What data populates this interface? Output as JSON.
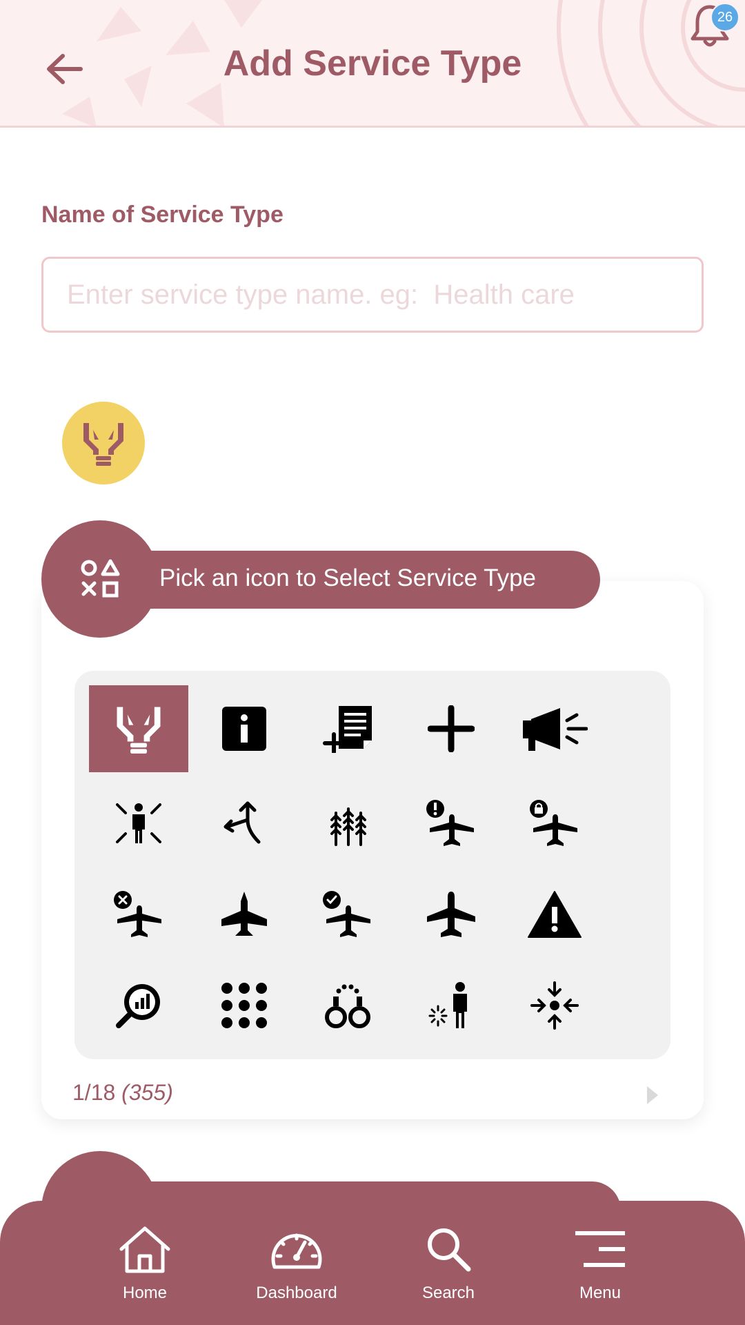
{
  "header": {
    "title": "Add Service Type",
    "notification_count": "26",
    "icons": {
      "back": "arrow-left-icon",
      "notifications": "bell-icon"
    }
  },
  "form": {
    "name_label": "Name of Service Type",
    "name_value": "",
    "name_placeholder": "Enter service type name. eg:  Health care",
    "selected_icon": "hands-holding-child-icon"
  },
  "picker": {
    "title": "Pick an icon to Select Service Type",
    "header_icon": "shapes-icon",
    "page": "1/18",
    "total": "(355)",
    "selected_index": 0,
    "icons": [
      "hands-holding-child-icon",
      "info-icon",
      "file-circle-plus-icon",
      "plus-icon",
      "bullhorn-icon",
      "person-burst-icon",
      "route-split-icon",
      "wheat-awn-icon",
      "plane-circle-exclamation-icon",
      "plane-lock-icon",
      "plane-circle-xmark-icon",
      "fighter-jet-icon",
      "plane-circle-check-icon",
      "plane-icon",
      "triangle-exclamation-icon",
      "magnifying-glass-chart-icon",
      "grid-dots-icon",
      "handcuffs-icon",
      "person-rays-icon",
      "arrows-to-dot-icon"
    ]
  },
  "nav": {
    "items": [
      {
        "label": "Home",
        "icon": "home-icon"
      },
      {
        "label": "Dashboard",
        "icon": "gauge-icon"
      },
      {
        "label": "Search",
        "icon": "search-icon"
      },
      {
        "label": "Menu",
        "icon": "menu-icon"
      }
    ]
  },
  "colors": {
    "primary": "#9e5a65",
    "header_bg": "#fdf0f0",
    "accent_yellow": "#f2d264",
    "badge": "#5aa8e6",
    "grid_bg": "#f1f1f1"
  }
}
